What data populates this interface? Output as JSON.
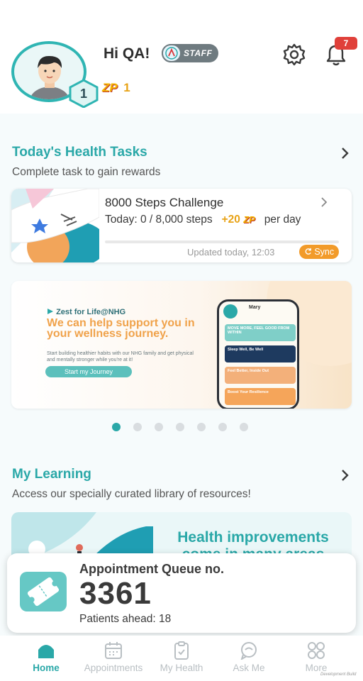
{
  "header": {
    "greeting": "Hi QA!",
    "staff_badge": "STAFF",
    "level": "1",
    "zp_logo": "ZP",
    "zp_points": "1",
    "notification_count": "7",
    "icons": {
      "settings": "gear-icon",
      "notifications": "bell-icon"
    }
  },
  "health_tasks": {
    "title": "Today's Health Tasks",
    "subtitle": "Complete task to gain rewards",
    "task": {
      "title": "8000 Steps Challenge",
      "today_label": "Today: 0 / 8,000 steps",
      "reward": "+20",
      "reward_unit": "ZP",
      "per_day": "per day",
      "progress_fraction": 0,
      "updated": "Updated today, 12:03",
      "sync_label": "Sync"
    }
  },
  "banner": {
    "brand": "Zest for Life@NHG",
    "headline": "We can help support you in your wellness journey.",
    "body": "Start building healthier habits with our NHG family and get physical and mentally stronger while you're at it!",
    "cta": "Start my Journey",
    "phone_name": "Mary",
    "phone_chips": [
      "MOVE MORE, FEEL GOOD FROM WITHIN",
      "Sleep Well, Be Well",
      "Feel Better, Inside Out",
      "Boost Your Resilience"
    ]
  },
  "carousel": {
    "total": 7,
    "active_index": 0
  },
  "learning": {
    "title": "My Learning",
    "subtitle": "Access our specially curated library of resources!",
    "card_text": "Health improvements come in many areas"
  },
  "queue": {
    "label": "Appointment Queue no.",
    "number": "3361",
    "patients_ahead": "Patients ahead: 18"
  },
  "nav": {
    "items": [
      {
        "label": "Home",
        "icon": "home-icon",
        "active": true
      },
      {
        "label": "Appointments",
        "icon": "calendar-icon",
        "active": false
      },
      {
        "label": "My Health",
        "icon": "clipboard-icon",
        "active": false
      },
      {
        "label": "Ask Me",
        "icon": "chat-icon",
        "active": false
      },
      {
        "label": "More",
        "icon": "grid-icon",
        "active": false
      }
    ]
  },
  "footer": {
    "dev_build": "Development Build"
  },
  "colors": {
    "accent": "#2aa8a8",
    "reward": "#e8a317",
    "badge": "#e0403a",
    "sync": "#f29b2a"
  }
}
